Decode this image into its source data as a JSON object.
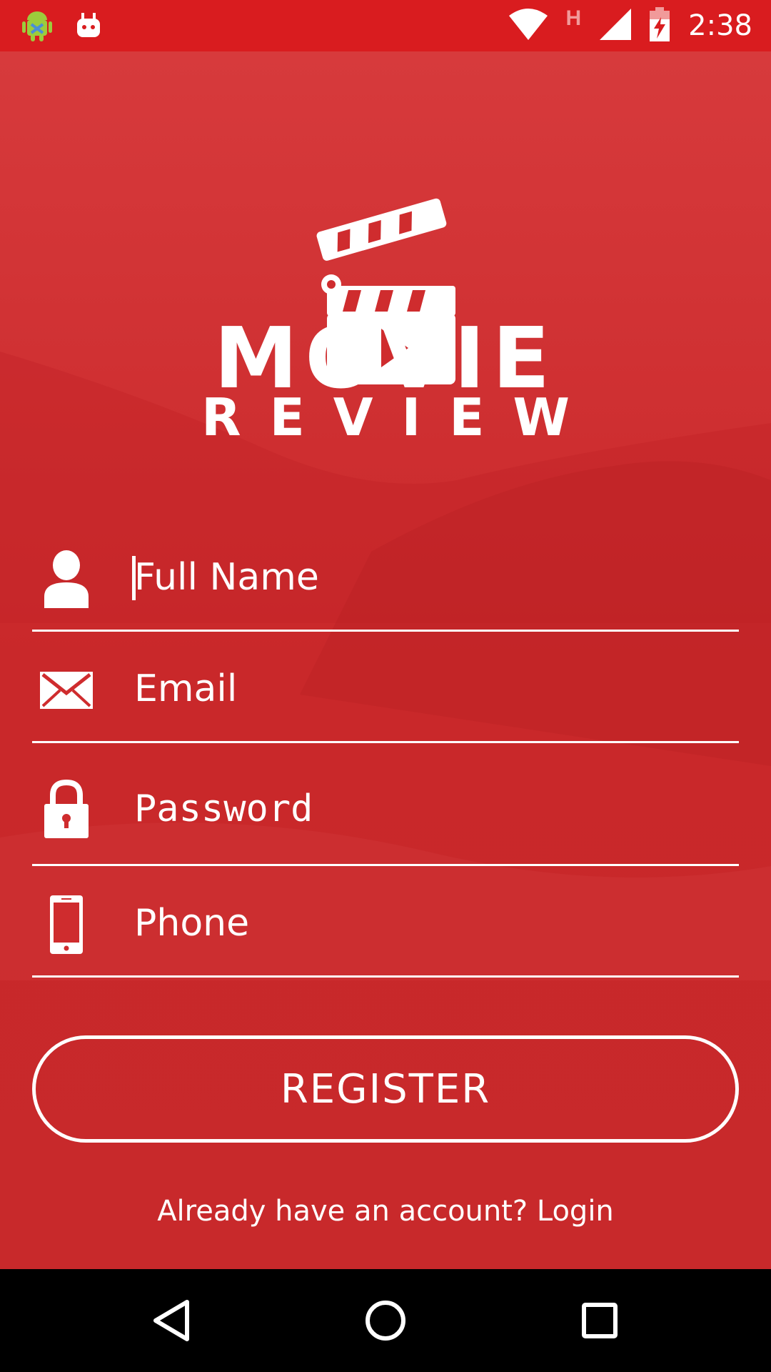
{
  "status_bar": {
    "time": "2:38",
    "network_indicator": "H",
    "icons": [
      "android-debug-icon",
      "android-notification-icon",
      "wifi-icon",
      "signal-icon",
      "battery-charging-icon"
    ],
    "background_color": "#d91c1f"
  },
  "logo": {
    "title_line1": "MOVIE",
    "title_line2": "REVIEW",
    "icon": "clapperboard-icon"
  },
  "form": {
    "full_name": {
      "placeholder": "Full Name",
      "icon": "user-icon"
    },
    "email": {
      "placeholder": "Email",
      "icon": "envelope-icon"
    },
    "password": {
      "placeholder": "Password",
      "icon": "lock-icon"
    },
    "phone": {
      "placeholder": "Phone",
      "icon": "phone-icon"
    }
  },
  "register_button": "REGISTER",
  "login_prompt": {
    "text": "Already have an account?",
    "link": "Login"
  },
  "nav_bar": {
    "icons": [
      "back-icon",
      "home-icon",
      "recents-icon"
    ]
  },
  "theme": {
    "accent": "#cf2c2e",
    "text": "#ffffff"
  }
}
